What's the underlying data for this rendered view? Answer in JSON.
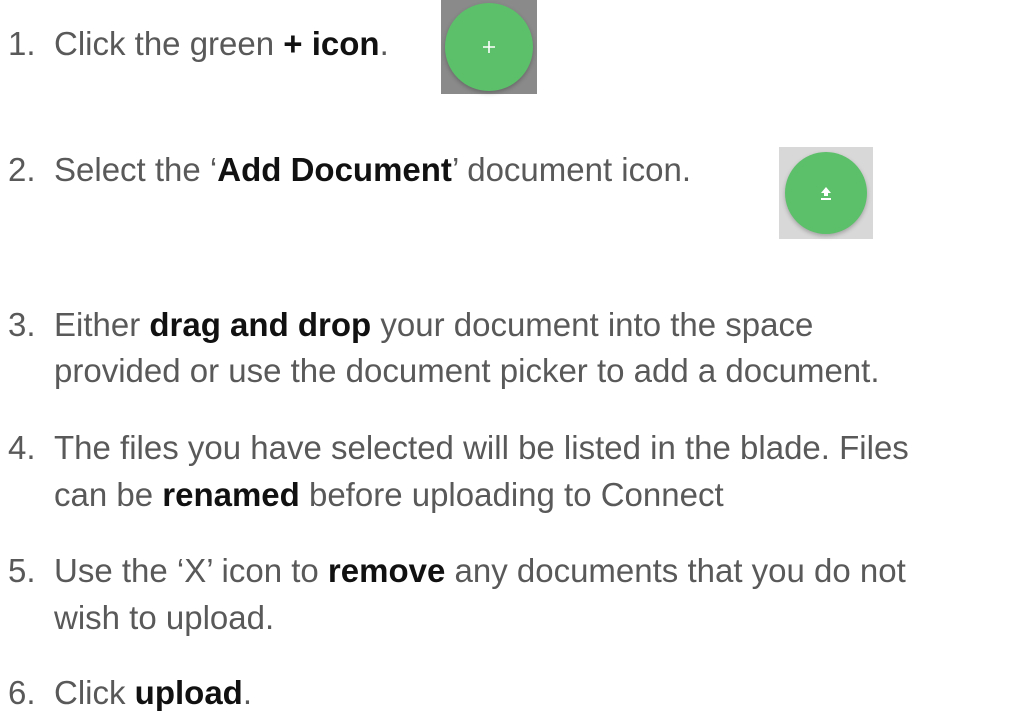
{
  "steps": [
    {
      "num": "1.",
      "pre": "Click the green ",
      "bold": "+ icon",
      "post": "."
    },
    {
      "num": "2.",
      "pre": "Select the ‘",
      "bold": "Add Document",
      "post": "’ document icon."
    },
    {
      "num": "3.",
      "pre": "Either ",
      "bold": "drag and drop",
      "post": " your document into the space",
      "line2": "provided or use the document picker to add a document."
    },
    {
      "num": "4.",
      "pre": "The files you have selected will be listed in the blade. Files",
      "line2_pre": "can be ",
      "line2_bold": "renamed",
      "line2_post": " before uploading to Connect"
    },
    {
      "num": "5.",
      "pre": "Use the ‘X’ icon to ",
      "bold": "remove",
      "post": " any documents that you do not",
      "line2": "wish to upload."
    },
    {
      "num": "6.",
      "pre": "Click ",
      "bold": "upload",
      "post": "."
    }
  ],
  "icons": {
    "plus": "add-icon",
    "upload": "upload-icon"
  },
  "colors": {
    "fab_green": "#5cc06a",
    "text": "#595959",
    "bold_text": "#111111"
  }
}
